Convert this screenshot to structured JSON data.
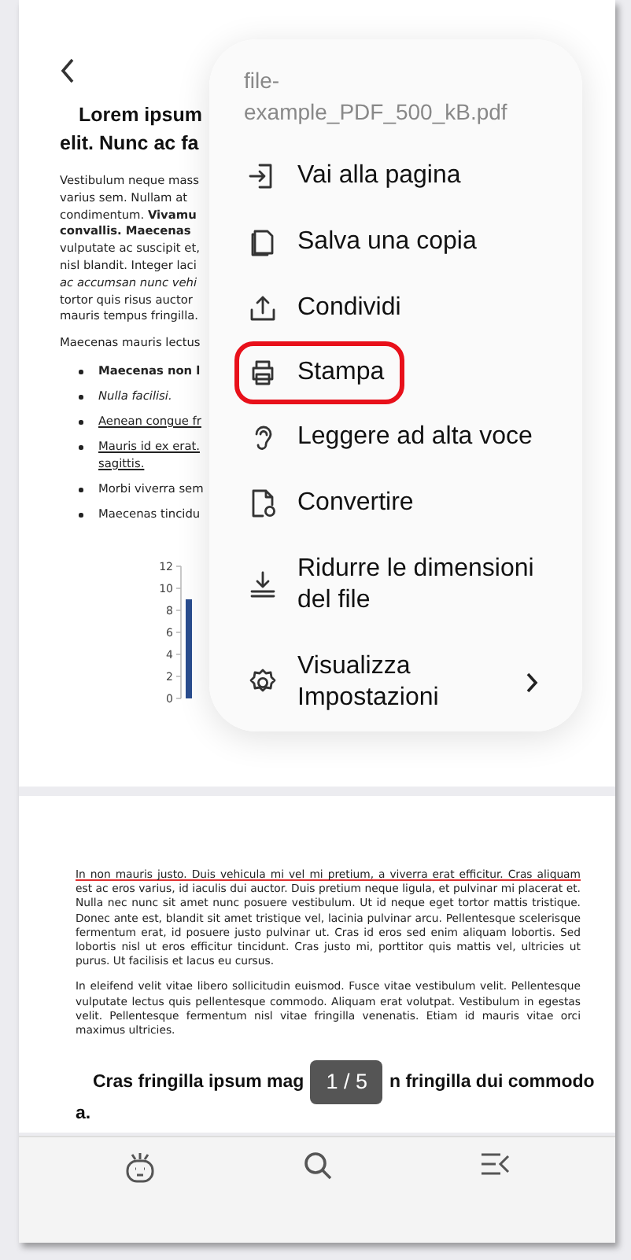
{
  "page_1": {
    "heading_lines": [
      "Lorem ipsum",
      "elit. Nunc ac fa"
    ],
    "paragraph_lines": [
      "Vestibulum neque mass",
      "varius sem. Nullam at",
      "condimentum. **Vivamu**",
      "**convallis. Maecenas**",
      "vulputate ac suscipit et,",
      "nisl blandit. Integer laci",
      "*ac accumsan nunc vehi*",
      "tortor quis risus auctor",
      "mauris tempus fringilla."
    ],
    "intro_line": "Maecenas mauris lectus",
    "bullets": [
      {
        "lines": [
          "Maecenas non l"
        ],
        "kind": "strong"
      },
      {
        "lines": [
          "Nulla facilisi."
        ],
        "kind": "emphasis"
      },
      {
        "lines": [
          "Aenean congue fr"
        ],
        "kind": "link"
      },
      {
        "lines": [
          "Mauris id ex erat.",
          "sagittis."
        ],
        "kind": "link"
      },
      {
        "lines": [
          "Morbi viverra sem"
        ],
        "kind": "normal"
      },
      {
        "lines": [
          "Maecenas tincidu"
        ],
        "kind": "normal"
      }
    ],
    "chart_axis_labels": [
      "12",
      "10",
      "8",
      "6",
      "4",
      "2",
      "0"
    ]
  },
  "page_2": {
    "paragraphs": [
      {
        "annotated_text": "In non mauris justo. Duis vehicula mi vel mi pretium, a viverra erat efficitur. Cras aliquam",
        "text": " est ac eros varius, id iaculis dui auctor. Duis pretium neque ligula, et pulvinar mi placerat et. Nulla nec nunc sit amet nunc posuere vestibulum. Ut id neque eget tortor mattis tristique. Donec ante est, blandit sit amet tristique vel, lacinia pulvinar arcu. Pellentesque scelerisque fermentum erat, id posuere justo pulvinar ut. Cras id eros sed enim aliquam lobortis. Sed lobortis nisl ut eros efficitur tincidunt. Cras justo mi, porttitor quis mattis vel, ultricies ut purus. Ut facilisis et lacus eu cursus."
      },
      {
        "text": "In eleifend velit vitae libero sollicitudin euismod. Fusce vitae vestibulum velit. Pellentesque vulputate lectus quis pellentesque commodo. Aliquam erat volutpat. Vestibulum in egestas velit. Pellentesque fermentum nisl vitae fringilla venenatis. Etiam id mauris vitae orci maximus ultricies."
      }
    ],
    "heading_left": "Cras fringilla ipsum mag",
    "heading_right": "n fringilla dui commodo",
    "heading_end": "a."
  },
  "page_indicator": "1 / 5",
  "menu": {
    "title": "file-example_PDF_500_kB.pdf",
    "items": [
      {
        "label": "Vai alla pagina",
        "highlighted": false,
        "has_submenu": false
      },
      {
        "label": "Salva una copia",
        "highlighted": false,
        "has_submenu": false
      },
      {
        "label": "Condividi",
        "highlighted": false,
        "has_submenu": false
      },
      {
        "label": "Stampa",
        "highlighted": true,
        "has_submenu": false
      },
      {
        "label": "Leggere ad alta voce",
        "highlighted": false,
        "has_submenu": false
      },
      {
        "label": "Convertire",
        "highlighted": false,
        "has_submenu": false
      },
      {
        "label": "Ridurre le dimensioni del file",
        "highlighted": false,
        "has_submenu": false
      },
      {
        "label": "Visualizza Impostazioni",
        "highlighted": false,
        "has_submenu": true
      }
    ]
  }
}
